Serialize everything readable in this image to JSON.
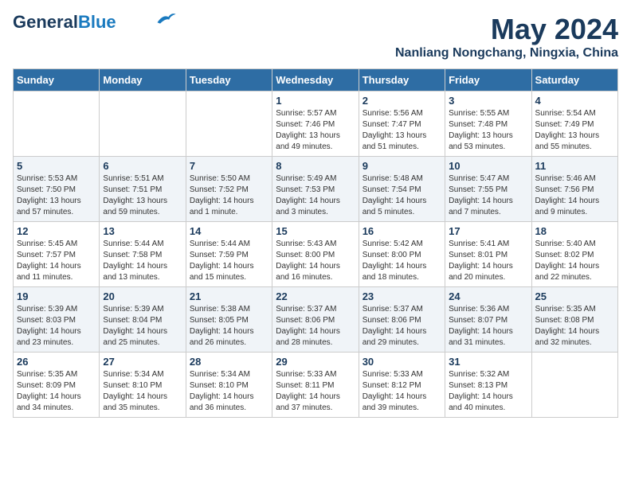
{
  "header": {
    "logo_line1": "General",
    "logo_line2": "Blue",
    "main_title": "May 2024",
    "subtitle": "Nanliang Nongchang, Ningxia, China"
  },
  "weekdays": [
    "Sunday",
    "Monday",
    "Tuesday",
    "Wednesday",
    "Thursday",
    "Friday",
    "Saturday"
  ],
  "weeks": [
    [
      {
        "day": "",
        "info": ""
      },
      {
        "day": "",
        "info": ""
      },
      {
        "day": "",
        "info": ""
      },
      {
        "day": "1",
        "info": "Sunrise: 5:57 AM\nSunset: 7:46 PM\nDaylight: 13 hours\nand 49 minutes."
      },
      {
        "day": "2",
        "info": "Sunrise: 5:56 AM\nSunset: 7:47 PM\nDaylight: 13 hours\nand 51 minutes."
      },
      {
        "day": "3",
        "info": "Sunrise: 5:55 AM\nSunset: 7:48 PM\nDaylight: 13 hours\nand 53 minutes."
      },
      {
        "day": "4",
        "info": "Sunrise: 5:54 AM\nSunset: 7:49 PM\nDaylight: 13 hours\nand 55 minutes."
      }
    ],
    [
      {
        "day": "5",
        "info": "Sunrise: 5:53 AM\nSunset: 7:50 PM\nDaylight: 13 hours\nand 57 minutes."
      },
      {
        "day": "6",
        "info": "Sunrise: 5:51 AM\nSunset: 7:51 PM\nDaylight: 13 hours\nand 59 minutes."
      },
      {
        "day": "7",
        "info": "Sunrise: 5:50 AM\nSunset: 7:52 PM\nDaylight: 14 hours\nand 1 minute."
      },
      {
        "day": "8",
        "info": "Sunrise: 5:49 AM\nSunset: 7:53 PM\nDaylight: 14 hours\nand 3 minutes."
      },
      {
        "day": "9",
        "info": "Sunrise: 5:48 AM\nSunset: 7:54 PM\nDaylight: 14 hours\nand 5 minutes."
      },
      {
        "day": "10",
        "info": "Sunrise: 5:47 AM\nSunset: 7:55 PM\nDaylight: 14 hours\nand 7 minutes."
      },
      {
        "day": "11",
        "info": "Sunrise: 5:46 AM\nSunset: 7:56 PM\nDaylight: 14 hours\nand 9 minutes."
      }
    ],
    [
      {
        "day": "12",
        "info": "Sunrise: 5:45 AM\nSunset: 7:57 PM\nDaylight: 14 hours\nand 11 minutes."
      },
      {
        "day": "13",
        "info": "Sunrise: 5:44 AM\nSunset: 7:58 PM\nDaylight: 14 hours\nand 13 minutes."
      },
      {
        "day": "14",
        "info": "Sunrise: 5:44 AM\nSunset: 7:59 PM\nDaylight: 14 hours\nand 15 minutes."
      },
      {
        "day": "15",
        "info": "Sunrise: 5:43 AM\nSunset: 8:00 PM\nDaylight: 14 hours\nand 16 minutes."
      },
      {
        "day": "16",
        "info": "Sunrise: 5:42 AM\nSunset: 8:00 PM\nDaylight: 14 hours\nand 18 minutes."
      },
      {
        "day": "17",
        "info": "Sunrise: 5:41 AM\nSunset: 8:01 PM\nDaylight: 14 hours\nand 20 minutes."
      },
      {
        "day": "18",
        "info": "Sunrise: 5:40 AM\nSunset: 8:02 PM\nDaylight: 14 hours\nand 22 minutes."
      }
    ],
    [
      {
        "day": "19",
        "info": "Sunrise: 5:39 AM\nSunset: 8:03 PM\nDaylight: 14 hours\nand 23 minutes."
      },
      {
        "day": "20",
        "info": "Sunrise: 5:39 AM\nSunset: 8:04 PM\nDaylight: 14 hours\nand 25 minutes."
      },
      {
        "day": "21",
        "info": "Sunrise: 5:38 AM\nSunset: 8:05 PM\nDaylight: 14 hours\nand 26 minutes."
      },
      {
        "day": "22",
        "info": "Sunrise: 5:37 AM\nSunset: 8:06 PM\nDaylight: 14 hours\nand 28 minutes."
      },
      {
        "day": "23",
        "info": "Sunrise: 5:37 AM\nSunset: 8:06 PM\nDaylight: 14 hours\nand 29 minutes."
      },
      {
        "day": "24",
        "info": "Sunrise: 5:36 AM\nSunset: 8:07 PM\nDaylight: 14 hours\nand 31 minutes."
      },
      {
        "day": "25",
        "info": "Sunrise: 5:35 AM\nSunset: 8:08 PM\nDaylight: 14 hours\nand 32 minutes."
      }
    ],
    [
      {
        "day": "26",
        "info": "Sunrise: 5:35 AM\nSunset: 8:09 PM\nDaylight: 14 hours\nand 34 minutes."
      },
      {
        "day": "27",
        "info": "Sunrise: 5:34 AM\nSunset: 8:10 PM\nDaylight: 14 hours\nand 35 minutes."
      },
      {
        "day": "28",
        "info": "Sunrise: 5:34 AM\nSunset: 8:10 PM\nDaylight: 14 hours\nand 36 minutes."
      },
      {
        "day": "29",
        "info": "Sunrise: 5:33 AM\nSunset: 8:11 PM\nDaylight: 14 hours\nand 37 minutes."
      },
      {
        "day": "30",
        "info": "Sunrise: 5:33 AM\nSunset: 8:12 PM\nDaylight: 14 hours\nand 39 minutes."
      },
      {
        "day": "31",
        "info": "Sunrise: 5:32 AM\nSunset: 8:13 PM\nDaylight: 14 hours\nand 40 minutes."
      },
      {
        "day": "",
        "info": ""
      }
    ]
  ]
}
